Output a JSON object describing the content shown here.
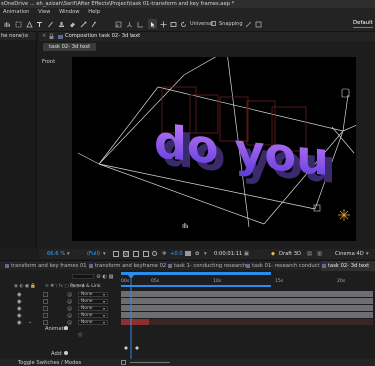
{
  "window": {
    "title": "sOneDrive ... eh_azizah\\Serif\\After Effects\\Project\\task 01-transform and key frames.aep *"
  },
  "menu": [
    "Animation",
    "View",
    "Window",
    "Help"
  ],
  "toolbar": {
    "universal_label": "Universal",
    "snapping_label": "Snapping",
    "workspace_label": "Default"
  },
  "left_panel": {
    "title": "he none)≡"
  },
  "comp_panel": {
    "tab_label": "Composition task 02- 3d text",
    "subtab_label": "task 02- 3d text",
    "view_label": "Front",
    "viewport_text": "do you"
  },
  "comp_footer": {
    "zoom": "66.6 %",
    "resolution": "(Full)",
    "exposure": "+0.0",
    "timecode": "0:00:01:11",
    "renderer": "Draft 3D",
    "renderer_engine": "Cinema 4D"
  },
  "timeline_tabs": [
    {
      "label": "transform and key frames 01",
      "active": false
    },
    {
      "label": "transform and keyframe 02",
      "active": false
    },
    {
      "label": "task 1- conducting research",
      "active": false
    },
    {
      "label": "task 01- research conduct 02",
      "active": false
    },
    {
      "label": "task 02- 3d text",
      "active": true
    }
  ],
  "timeline": {
    "parent_header": "Parent & Link",
    "parent_values": [
      "None",
      "None",
      "None",
      "None",
      "None"
    ],
    "animate_label": "Animate:",
    "add_label": "Add:",
    "bottom_label": "Toggle Switches / Modes",
    "ruler_labels": [
      "00s",
      "05s",
      "10s",
      "15s",
      "20s",
      "25s"
    ],
    "playhead_position": 0.06,
    "accent_color": "#2d8ceb"
  },
  "colors": {
    "text_gradient_top": "#c97dfb",
    "text_gradient_bottom": "#5a39d8",
    "track_red": "#8b2f2f",
    "track_gray": "#6d6d72"
  }
}
